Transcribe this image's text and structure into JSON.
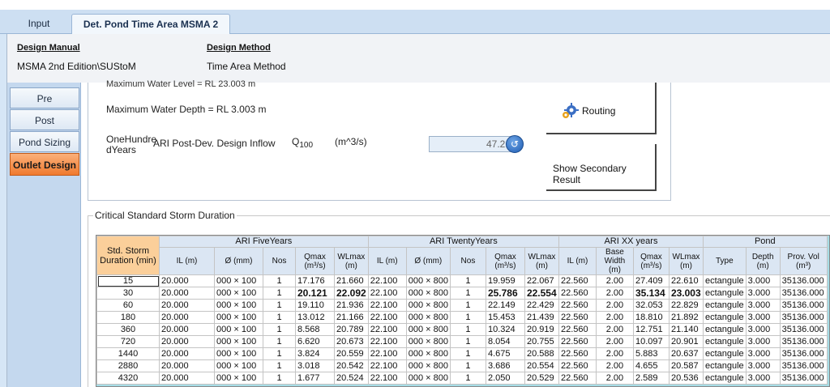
{
  "tabs": [
    {
      "label": "Input",
      "active": false
    },
    {
      "label": "Det. Pond Time Area MSMA 2",
      "active": true
    }
  ],
  "header": {
    "design_manual_label": "Design Manual",
    "design_manual_value": "MSMA 2nd Edition\\SUStoM",
    "design_method_label": "Design Method",
    "design_method_value": "Time Area Method"
  },
  "sidebar": {
    "items": [
      {
        "label": "Pre",
        "active": false
      },
      {
        "label": "Post",
        "active": false
      },
      {
        "label": "Pond Sizing",
        "active": false
      },
      {
        "label": "Outlet Design",
        "active": true
      }
    ]
  },
  "upper": {
    "cut_text": "Maximum Water Level = RL 23.003 m",
    "max_depth": "Maximum Water Depth = RL 3.003 m",
    "ari_left": "OneHundre",
    "ari_left2": "dYears",
    "ari_desc": "ARI Post-Dev. Design Inflow",
    "q_symbol": "Q",
    "q_sub": "100",
    "q_unit": "(m^3/s)",
    "q_value": "47.21",
    "routing_label": "Routing",
    "secondary_label": "Show Secondary Result"
  },
  "group": {
    "title": "Critical Standard Storm Duration"
  },
  "table": {
    "corner": "Std. Storm Duration (min)",
    "groups": [
      "ARI FiveYears",
      "ARI TwentyYears",
      "ARI XX years",
      "Pond"
    ],
    "cols_five": [
      "IL (m)",
      "Ø (mm)",
      "Nos",
      "Qmax (m³/s)",
      "WLmax (m)"
    ],
    "cols_twenty": [
      "IL (m)",
      "Ø (mm)",
      "Nos",
      "Qmax (m³/s)",
      "WLmax (m)"
    ],
    "cols_xx": [
      "IL (m)",
      "Base Width (m)",
      "Qmax (m³/s)",
      "WLmax (m)"
    ],
    "cols_pond": [
      "Type",
      "Depth (m)",
      "Prov. Vol (m³)"
    ],
    "rows": [
      {
        "dur": "15",
        "f": [
          "20.000",
          "000 × 100",
          "1",
          "17.176",
          "21.660"
        ],
        "t": [
          "22.100",
          "000 × 800",
          "1",
          "19.959",
          "22.067"
        ],
        "x": [
          "22.560",
          "2.00",
          "27.409",
          "22.610"
        ],
        "p": [
          "ectangule",
          "3.000",
          "35136.000"
        ],
        "bold": false
      },
      {
        "dur": "30",
        "f": [
          "20.000",
          "000 × 100",
          "1",
          "20.121",
          "22.092"
        ],
        "t": [
          "22.100",
          "000 × 800",
          "1",
          "25.786",
          "22.554"
        ],
        "x": [
          "22.560",
          "2.00",
          "35.134",
          "23.003"
        ],
        "p": [
          "ectangule",
          "3.000",
          "35136.000"
        ],
        "bold": true
      },
      {
        "dur": "60",
        "f": [
          "20.000",
          "000 × 100",
          "1",
          "19.110",
          "21.936"
        ],
        "t": [
          "22.100",
          "000 × 800",
          "1",
          "22.149",
          "22.429"
        ],
        "x": [
          "22.560",
          "2.00",
          "32.053",
          "22.829"
        ],
        "p": [
          "ectangule",
          "3.000",
          "35136.000"
        ],
        "bold": false
      },
      {
        "dur": "180",
        "f": [
          "20.000",
          "000 × 100",
          "1",
          "13.012",
          "21.166"
        ],
        "t": [
          "22.100",
          "000 × 800",
          "1",
          "15.453",
          "21.439"
        ],
        "x": [
          "22.560",
          "2.00",
          "18.810",
          "21.892"
        ],
        "p": [
          "ectangule",
          "3.000",
          "35136.000"
        ],
        "bold": false
      },
      {
        "dur": "360",
        "f": [
          "20.000",
          "000 × 100",
          "1",
          "8.568",
          "20.789"
        ],
        "t": [
          "22.100",
          "000 × 800",
          "1",
          "10.324",
          "20.919"
        ],
        "x": [
          "22.560",
          "2.00",
          "12.751",
          "21.140"
        ],
        "p": [
          "ectangule",
          "3.000",
          "35136.000"
        ],
        "bold": false
      },
      {
        "dur": "720",
        "f": [
          "20.000",
          "000 × 100",
          "1",
          "6.620",
          "20.673"
        ],
        "t": [
          "22.100",
          "000 × 800",
          "1",
          "8.054",
          "20.755"
        ],
        "x": [
          "22.560",
          "2.00",
          "10.097",
          "20.901"
        ],
        "p": [
          "ectangule",
          "3.000",
          "35136.000"
        ],
        "bold": false
      },
      {
        "dur": "1440",
        "f": [
          "20.000",
          "000 × 100",
          "1",
          "3.824",
          "20.559"
        ],
        "t": [
          "22.100",
          "000 × 800",
          "1",
          "4.675",
          "20.588"
        ],
        "x": [
          "22.560",
          "2.00",
          "5.883",
          "20.637"
        ],
        "p": [
          "ectangule",
          "3.000",
          "35136.000"
        ],
        "bold": false
      },
      {
        "dur": "2880",
        "f": [
          "20.000",
          "000 × 100",
          "1",
          "3.018",
          "20.542"
        ],
        "t": [
          "22.100",
          "000 × 800",
          "1",
          "3.686",
          "20.554"
        ],
        "x": [
          "22.560",
          "2.00",
          "4.655",
          "20.587"
        ],
        "p": [
          "ectangule",
          "3.000",
          "35136.000"
        ],
        "bold": false
      },
      {
        "dur": "4320",
        "f": [
          "20.000",
          "000 × 100",
          "1",
          "1.677",
          "20.524"
        ],
        "t": [
          "22.100",
          "000 × 800",
          "1",
          "2.050",
          "20.529"
        ],
        "x": [
          "22.560",
          "2.00",
          "2.589",
          "20.536"
        ],
        "p": [
          "ectangule",
          "3.000",
          "35136.000"
        ],
        "bold": false
      }
    ]
  },
  "colors": {
    "active_side_tab": "#f07a2e",
    "grid_background": "#a6dde6",
    "corner_header": "#fbcf9a"
  }
}
